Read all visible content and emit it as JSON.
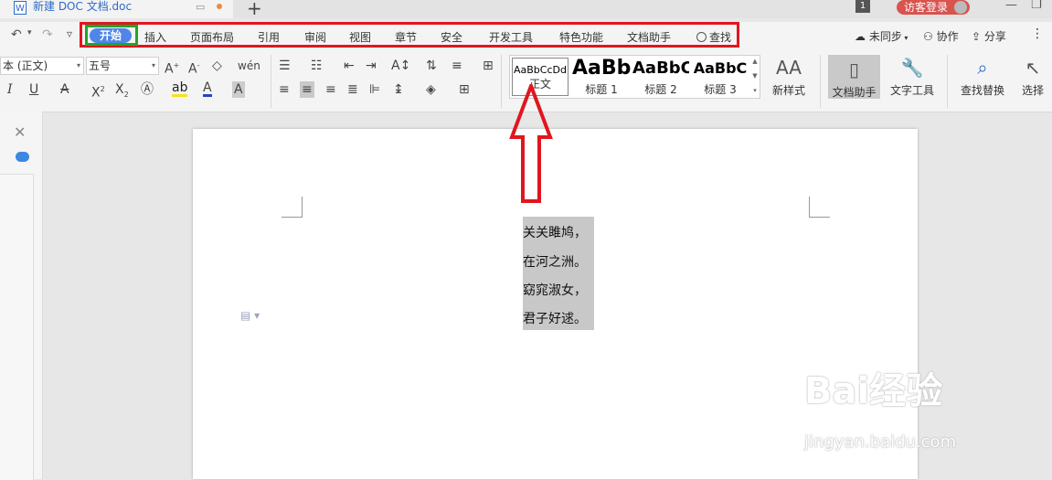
{
  "titlebar": {
    "doc_title": "新建 DOC 文档.doc",
    "doc_icon": "W",
    "new_tab": "+",
    "page_badge": "1",
    "login_label": "访客登录",
    "minimize": "—",
    "restore": "❐"
  },
  "quick_access": {
    "undo": "↶",
    "undo_arrow": "▾",
    "redo": "↷",
    "customize": "▿"
  },
  "menu": {
    "items": [
      "开始",
      "插入",
      "页面布局",
      "引用",
      "审阅",
      "视图",
      "章节",
      "安全",
      "开发工具",
      "特色功能",
      "文档助手",
      "查找"
    ],
    "right": [
      "未同步",
      "协作",
      "分享"
    ],
    "more": "⋮"
  },
  "ribbon": {
    "font_name": "本 (正文)",
    "font_size": "五号",
    "styles": [
      {
        "sample": "AaBbCcDd",
        "label": "正文"
      },
      {
        "sample": "AaBb",
        "label": "标题 1"
      },
      {
        "sample": "AaBbC",
        "label": "标题 2"
      },
      {
        "sample": "AaBbC",
        "label": "标题 3"
      }
    ],
    "buttons": {
      "new_style": "新样式",
      "doc_assistant": "文档助手",
      "text_tools": "文字工具",
      "find_replace": "查找替换",
      "select": "选择"
    }
  },
  "document": {
    "lines": [
      "关关雎鸠，",
      "在河之洲。",
      "窈窕淑女，",
      "君子好逑。"
    ]
  },
  "watermark": {
    "brand": "Bai经验",
    "url": "jingyan.baidu.com"
  },
  "colors": {
    "highlight_frame": "#e0161f",
    "start_frame": "#1ea52a",
    "start_pill": "#4f86e8"
  }
}
